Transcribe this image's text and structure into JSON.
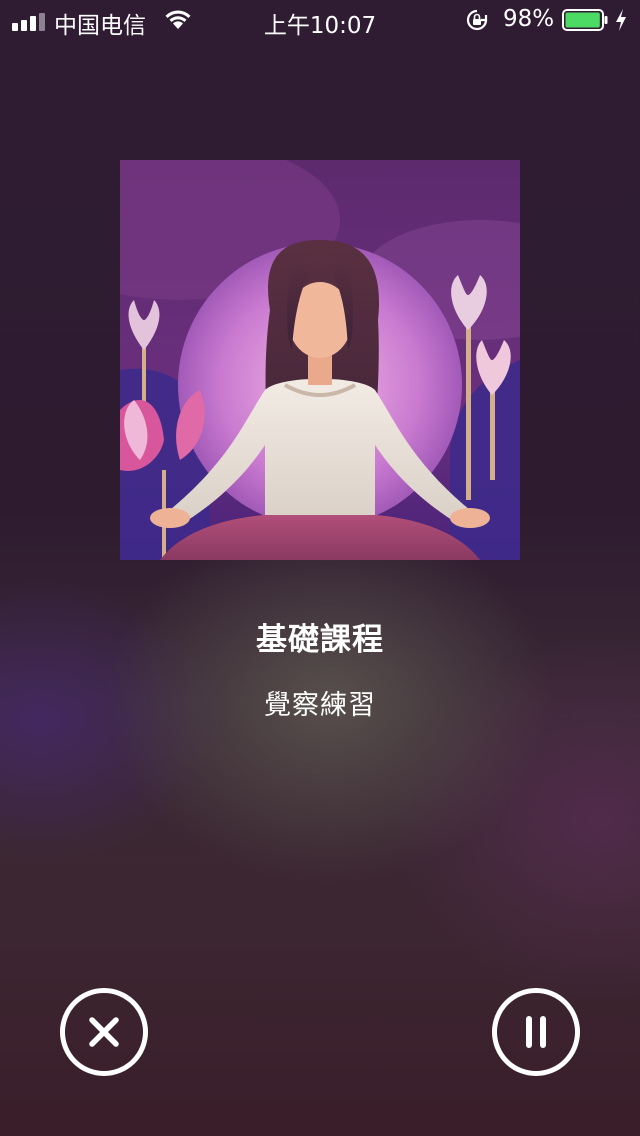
{
  "status_bar": {
    "carrier": "中国电信",
    "time": "上午10:07",
    "battery_percent": "98%",
    "battery_level": 0.98,
    "battery_color": "#4cd964",
    "icons": [
      "signal-icon",
      "wifi-icon",
      "rotation-lock-icon",
      "battery-icon",
      "charging-icon"
    ]
  },
  "player": {
    "artwork_icon": "meditation-woman-lotus-artwork",
    "title": "基礎課程",
    "subtitle": "覺察練習"
  },
  "controls": {
    "close_icon": "close-icon",
    "pause_icon": "pause-icon"
  }
}
